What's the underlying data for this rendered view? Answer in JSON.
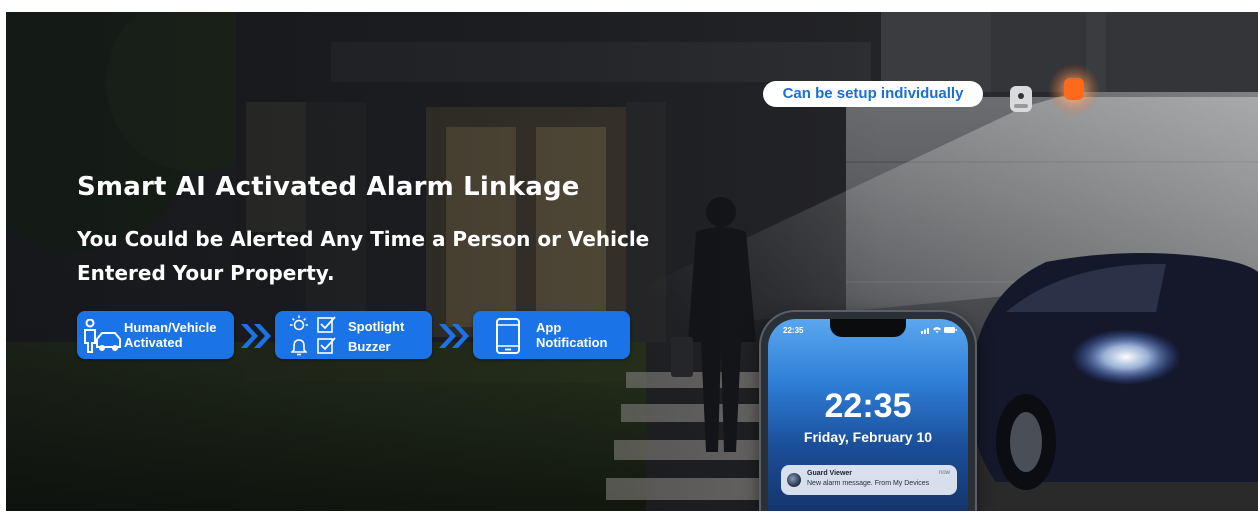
{
  "banner": {
    "title": "Smart AI Activated Alarm Linkage",
    "subtitle": "You Could be Alerted Any Time a Person or Vehicle Entered Your Property.",
    "badge": "Can be setup individually"
  },
  "steps": [
    {
      "line1": "Human/Vehicle",
      "line2": "Activated",
      "icon": "human-vehicle-icon"
    },
    {
      "line1": "Spotlight",
      "line2": "Buzzer",
      "icons": [
        "light-bulb-icon",
        "bell-icon",
        "checkbox-icon"
      ]
    },
    {
      "line1": "App",
      "line2": "Notification",
      "icon": "smartphone-icon"
    }
  ],
  "phone": {
    "status_time": "22:35",
    "lock_time": "22:35",
    "date": "Friday, February 10",
    "notification": {
      "app": "Guard Viewer",
      "time": "now",
      "message": "New alarm message. From My Devices"
    }
  },
  "colors": {
    "accent": "#1a74e8",
    "badge_text": "#1a6fd6",
    "alarm_light": "#ff6a1a",
    "text": "#ffffff"
  }
}
